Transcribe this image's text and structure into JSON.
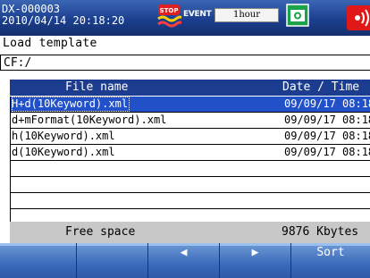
{
  "status": {
    "device_id": "DX-000003",
    "datetime": "2010/04/14 20:18:20",
    "event_label": "EVENT",
    "interval": "1hour"
  },
  "dialog": {
    "title": "Load template",
    "path": "CF:/"
  },
  "table": {
    "headers": {
      "name": "File name",
      "date": "Date / Time"
    },
    "rows": [
      {
        "name": "H+d(10Keyword).xml",
        "date": "09/09/17 08:18"
      },
      {
        "name": "d+mFormat(10Keyword).xml",
        "date": "09/09/17 08:18"
      },
      {
        "name": "h(10Keyword).xml",
        "date": "09/09/17 08:18"
      },
      {
        "name": "d(10Keyword).xml",
        "date": "09/09/17 08:18"
      }
    ],
    "selected_index": 0
  },
  "footer": {
    "free_label": "Free space",
    "free_value": "9876 Kbytes"
  },
  "softkeys": [
    {
      "label": ""
    },
    {
      "label": ""
    },
    {
      "label": "◀"
    },
    {
      "label": "▶"
    },
    {
      "label": "Sort"
    }
  ],
  "colors": {
    "header_bar": "#1c3d8f",
    "selection": "#2250c8",
    "softkey": "#3b6bbb"
  }
}
